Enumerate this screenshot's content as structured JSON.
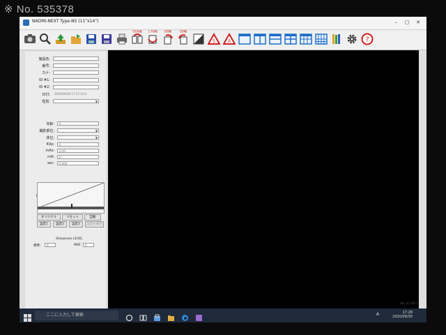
{
  "watermark": "※ No. 535378",
  "window": {
    "title": "NAOMI-NEXT Type-NS  (11\"x14\")",
    "min": "–",
    "max": "▢",
    "close": "✕"
  },
  "toolbar": {
    "icons": [
      "camera-icon",
      "magnifier-icon",
      "upload-icon",
      "folder-open-icon",
      "save-icon",
      "save-as-icon",
      "print-icon",
      "rotate-left-icon",
      "rotate-right-icon",
      "flip-horizontal-icon",
      "flip-vertical-icon",
      "invert-icon",
      "warning-triangle-icon",
      "warning-triangle-2-icon",
      "layout-1-icon",
      "layout-2-icon",
      "layout-3-icon",
      "layout-4-icon",
      "layout-5-icon",
      "layout-6-icon",
      "library-icon",
      "gear-icon",
      "help-icon"
    ],
    "red_labels": [
      "左右反転",
      "上下反転",
      "右回転",
      "左回転"
    ]
  },
  "form": {
    "patient_name_label": "施設名:",
    "number_label": "番号:",
    "kana_label": "カナ:",
    "id1_label": "ID #1:",
    "id2_label": "ID #2:",
    "date_label": "日付:",
    "date_value": "2020/09/30 17:27:12.0",
    "sex_label": "性別:",
    "age_label": "年齢:",
    "age_value": "0",
    "part_label": "撮影部位:",
    "position_label": "体位:",
    "kvp_label": "KVp:",
    "kvp_value": "0",
    "mas_label": "mAs:",
    "mas_value": "0.00",
    "ma_label": "mA:",
    "ma_value": "0",
    "sec_label": "sec:",
    "sec_value": "0.000"
  },
  "histogram": {
    "title": "ヒストグラム"
  },
  "buttons": {
    "original": "オリジナル",
    "reset": "リセット",
    "auto": "自動",
    "preset1": "設定1",
    "preset2": "設定2",
    "preset3": "設定3",
    "preset_save": "設定を保存"
  },
  "sharpness": {
    "title": "Sharpness LEVEL",
    "standard_label": "標準:",
    "standard_value": "0",
    "mse_label": "MSE:",
    "mse_value": "0"
  },
  "version": "Ver 11.00.7",
  "taskbar": {
    "search_placeholder": "ここに入力して検索",
    "time": "17:28",
    "date": "2020/09/30",
    "lang": "A"
  }
}
